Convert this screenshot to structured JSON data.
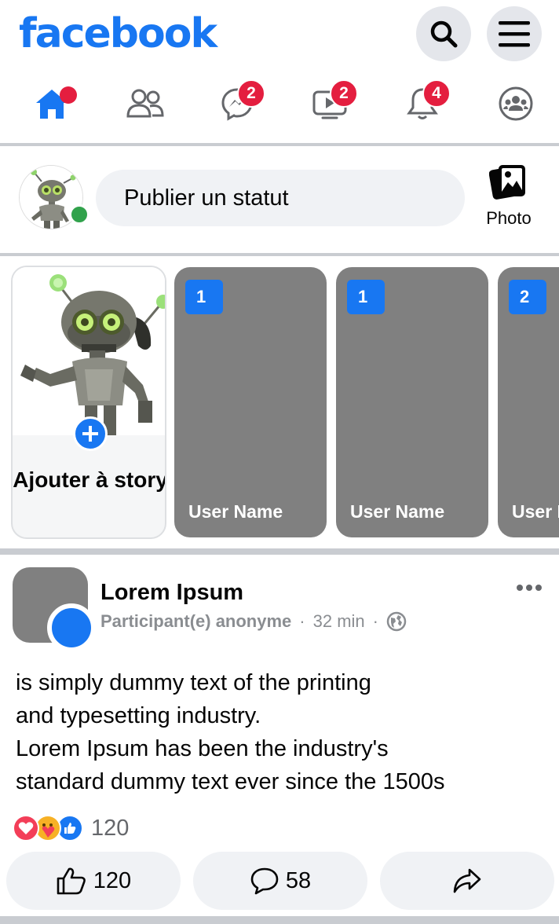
{
  "header": {
    "logo": "facebook",
    "search_icon": "search-icon",
    "menu_icon": "menu-icon"
  },
  "nav": {
    "items": [
      {
        "name": "home",
        "icon": "home-icon",
        "badge": "",
        "active": true
      },
      {
        "name": "friends",
        "icon": "friends-icon",
        "badge": ""
      },
      {
        "name": "messenger",
        "icon": "messenger-icon",
        "badge": "2"
      },
      {
        "name": "watch",
        "icon": "watch-icon",
        "badge": "2"
      },
      {
        "name": "notifications",
        "icon": "bell-icon",
        "badge": "4"
      },
      {
        "name": "groups",
        "icon": "groups-icon",
        "badge": ""
      }
    ]
  },
  "composer": {
    "placeholder": "Publier un statut",
    "photo_label": "Photo"
  },
  "stories": {
    "create_label": "Ajouter à story",
    "items": [
      {
        "count": "1",
        "user": "User Name"
      },
      {
        "count": "1",
        "user": "User Name"
      },
      {
        "count": "2",
        "user": "User Name"
      }
    ]
  },
  "post": {
    "author": "Lorem Ipsum",
    "audience": "Participant(e) anonyme",
    "time": "32 min",
    "text": "is simply dummy text of the printing\n and typesetting industry.\nLorem Ipsum has been the industry's\nstandard dummy text ever since the 1500s",
    "reaction_count": "120",
    "like_count": "120",
    "comment_count": "58"
  },
  "colors": {
    "brand": "#1877f2",
    "badge": "#e41e3f",
    "online": "#31a24c"
  }
}
